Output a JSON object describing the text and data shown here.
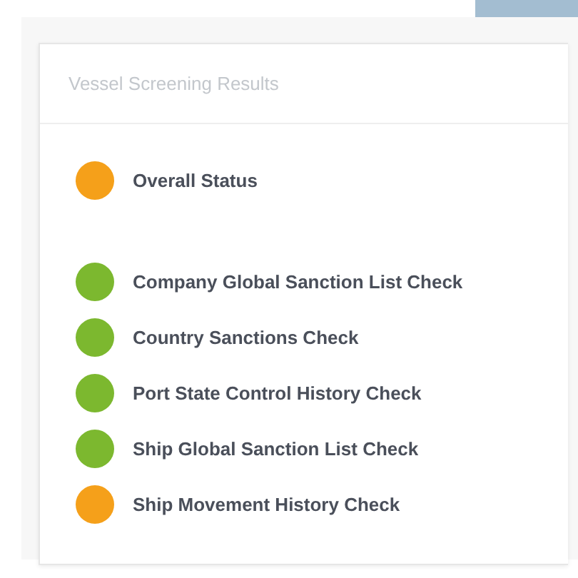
{
  "card": {
    "title": "Vessel Screening Results"
  },
  "overall": {
    "label": "Overall Status",
    "color": "#f5a01a"
  },
  "checks": [
    {
      "label": "Company Global Sanction List Check",
      "color": "#7cb82f"
    },
    {
      "label": "Country Sanctions Check",
      "color": "#7cb82f"
    },
    {
      "label": "Port State Control History Check",
      "color": "#7cb82f"
    },
    {
      "label": "Ship Global Sanction List Check",
      "color": "#7cb82f"
    },
    {
      "label": "Ship Movement History Check",
      "color": "#f5a01a"
    }
  ]
}
